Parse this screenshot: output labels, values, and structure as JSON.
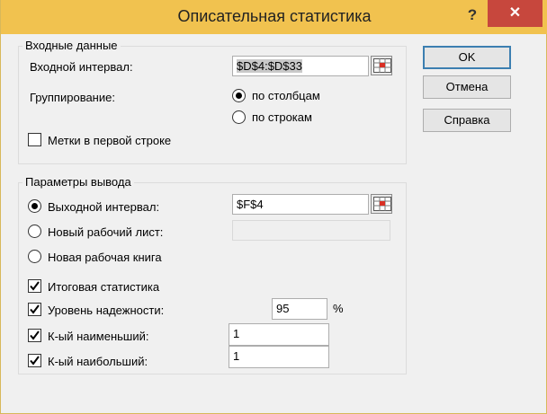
{
  "window": {
    "title": "Описательная статистика",
    "help_glyph": "?",
    "close_glyph": "✕"
  },
  "input": {
    "legend": "Входные данные",
    "range_label": "Входной интервал:",
    "range_value": "$D$4:$D$33",
    "grouping_label": "Группирование:",
    "by_columns": "по столбцам",
    "by_rows": "по строкам",
    "grouping_selected": "по столбцам",
    "labels_first_row": "Метки в первой строке",
    "labels_first_row_checked": false
  },
  "output": {
    "legend": "Параметры вывода",
    "output_range_label": "Выходной интервал:",
    "output_range_value": "$F$4",
    "new_sheet_label": "Новый рабочий лист:",
    "new_sheet_value": "",
    "new_book_label": "Новая рабочая книга",
    "selected": "Выходной интервал",
    "summary_stats_label": "Итоговая статистика",
    "summary_stats_checked": true,
    "confidence_label": "Уровень надежности:",
    "confidence_checked": true,
    "confidence_value": "95",
    "confidence_unit": "%",
    "kth_smallest_label": "К-ый наименьший:",
    "kth_smallest_checked": true,
    "kth_smallest_value": "1",
    "kth_largest_label": "К-ый наибольший:",
    "kth_largest_checked": true,
    "kth_largest_value": "1"
  },
  "buttons": {
    "ok": "OK",
    "cancel": "Отмена",
    "help": "Справка"
  },
  "colors": {
    "titlebar": "#f1c24f",
    "close": "#c7473d",
    "default_border": "#3c7fb1"
  },
  "icons": {
    "range_selector": "range-select-icon",
    "check": "checkmark-icon"
  }
}
